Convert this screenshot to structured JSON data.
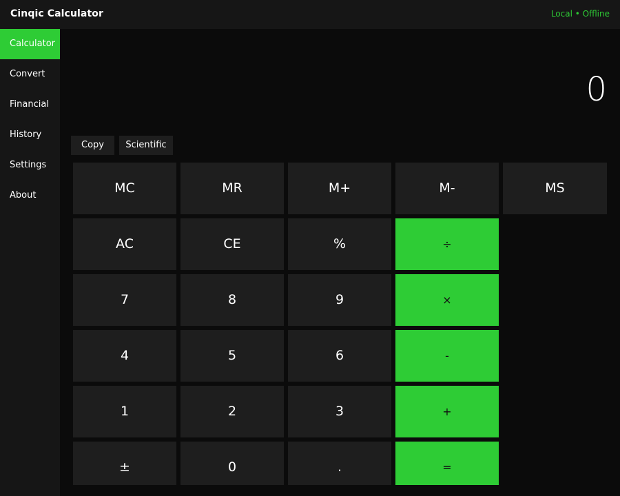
{
  "header": {
    "title": "Cinqic Calculator",
    "status": "Local • Offline"
  },
  "sidebar": {
    "items": [
      {
        "label": "Calculator",
        "active": true
      },
      {
        "label": "Convert",
        "active": false
      },
      {
        "label": "Financial",
        "active": false
      },
      {
        "label": "History",
        "active": false
      },
      {
        "label": "Settings",
        "active": false
      },
      {
        "label": "About",
        "active": false
      }
    ]
  },
  "display": {
    "value": "0"
  },
  "toolbar": {
    "copy_label": "Copy",
    "scientific_label": "Scientific"
  },
  "memory_keys": [
    "MC",
    "MR",
    "M+",
    "M-",
    "MS"
  ],
  "keypad": {
    "row1": [
      "AC",
      "CE",
      "%",
      "÷"
    ],
    "row2": [
      "7",
      "8",
      "9",
      "×"
    ],
    "row3": [
      "4",
      "5",
      "6",
      "-"
    ],
    "row4": [
      "1",
      "2",
      "3",
      "+"
    ],
    "row5": [
      "±",
      "0",
      ".",
      "="
    ]
  },
  "colors": {
    "accent": "#2ecc35",
    "background": "#0b0b0b",
    "panel": "#161616",
    "key": "#1e1e1e",
    "text": "#ffffff"
  }
}
